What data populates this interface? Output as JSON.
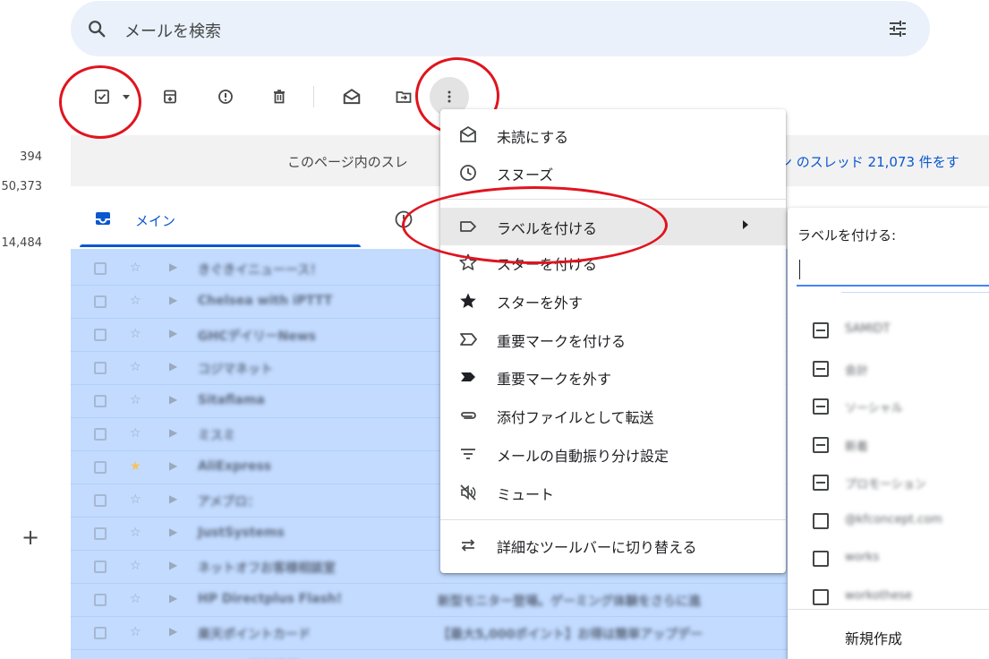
{
  "search": {
    "placeholder": "メールを検索",
    "icon": "search-icon",
    "options_icon": "tune-icon"
  },
  "counters": [
    "394",
    "50,373",
    "14,484"
  ],
  "compose_extra": "+",
  "toolbar": {
    "icons": [
      "select-checkbox-icon",
      "dropdown-caret-icon",
      "archive-icon",
      "report-spam-icon",
      "delete-icon",
      "mark-read-icon",
      "move-to-icon",
      "more-vert-icon"
    ]
  },
  "banner": {
    "text": "このページ内のスレ",
    "link": "ン のスレッド 21,073 件をす"
  },
  "tabs": {
    "main": "メイン"
  },
  "emails": [
    {
      "sender": "きぐきイニューース！",
      "snippet": ""
    },
    {
      "sender": "Chelsea with iPTTT",
      "snippet": ""
    },
    {
      "sender": "GHCデイリーNews",
      "snippet": ""
    },
    {
      "sender": "コジマネット",
      "snippet": ""
    },
    {
      "sender": "Sitaflama",
      "snippet": ""
    },
    {
      "sender": "ミスミ",
      "snippet": ""
    },
    {
      "sender": "AliExpress",
      "snippet": "",
      "starred": true
    },
    {
      "sender": "アメブロ：",
      "snippet": ""
    },
    {
      "sender": "JustSystems",
      "snippet": ""
    },
    {
      "sender": "ネットオフお客様相談室",
      "snippet": ""
    },
    {
      "sender": "HP Directplus Flash!",
      "snippet": "新型モニター登場。ゲーミング体験をさらに進"
    },
    {
      "sender": "楽天ポイントカード",
      "snippet": "【最大5,000ポイント】お得は簡単アップデー"
    },
    {
      "sender": "Lenovo特価情報",
      "snippet": ""
    }
  ],
  "menu": {
    "items": [
      {
        "label": "未読にする",
        "icon": "mark-unread-icon"
      },
      {
        "label": "スヌーズ",
        "icon": "snooze-icon"
      },
      {
        "label": "ラベルを付ける",
        "icon": "label-icon",
        "submenu": true
      },
      {
        "label": "スターを付ける",
        "icon": "star-outline-icon"
      },
      {
        "label": "スターを外す",
        "icon": "star-filled-icon"
      },
      {
        "label": "重要マークを付ける",
        "icon": "important-outline-icon"
      },
      {
        "label": "重要マークを外す",
        "icon": "important-filled-icon"
      },
      {
        "label": "添付ファイルとして転送",
        "icon": "attachment-icon"
      },
      {
        "label": "メールの自動振り分け設定",
        "icon": "filter-icon"
      },
      {
        "label": "ミュート",
        "icon": "mute-icon"
      },
      {
        "label": "詳細なツールバーに切り替える",
        "icon": "swap-icon"
      }
    ]
  },
  "label_menu": {
    "heading": "ラベルを付ける:",
    "input_value": "",
    "labels": [
      {
        "name": "SAMIDT",
        "state": "indeterminate"
      },
      {
        "name": "会計",
        "state": "indeterminate"
      },
      {
        "name": "ソーシャル",
        "state": "indeterminate"
      },
      {
        "name": "新着",
        "state": "indeterminate"
      },
      {
        "name": "プロモーション",
        "state": "indeterminate"
      },
      {
        "name": "@kfconcept.com",
        "state": "unchecked"
      },
      {
        "name": "works",
        "state": "unchecked"
      },
      {
        "name": "workothese",
        "state": "unchecked"
      }
    ],
    "new_label": "新規作成"
  },
  "colors": {
    "accent": "#0b57d0",
    "selection": "#c2dbff",
    "annotation": "#e0141e"
  }
}
